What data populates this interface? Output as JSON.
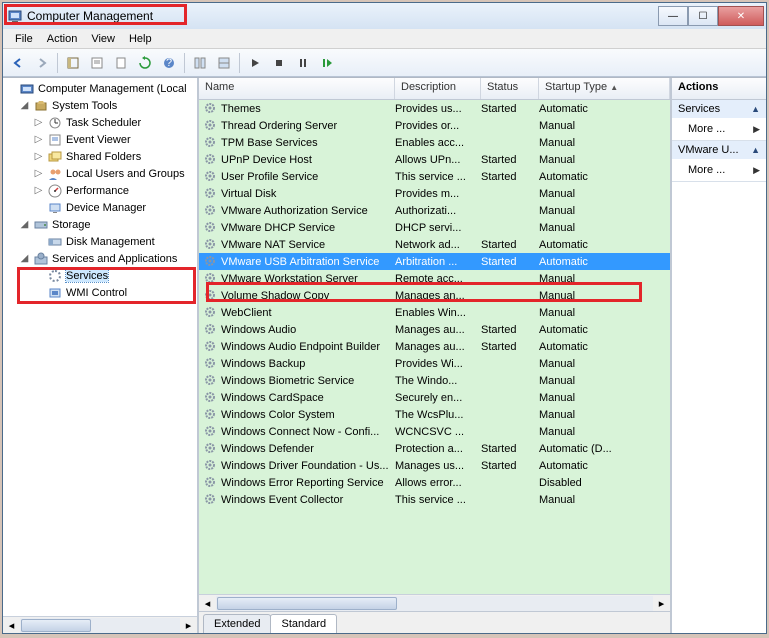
{
  "window": {
    "title": "Computer Management"
  },
  "menu": {
    "file": "File",
    "action": "Action",
    "view": "View",
    "help": "Help"
  },
  "tree": {
    "root": "Computer Management (Local",
    "systemTools": "System Tools",
    "taskScheduler": "Task Scheduler",
    "eventViewer": "Event Viewer",
    "sharedFolders": "Shared Folders",
    "localUsers": "Local Users and Groups",
    "performance": "Performance",
    "deviceManager": "Device Manager",
    "storage": "Storage",
    "diskManagement": "Disk Management",
    "servicesApps": "Services and Applications",
    "services": "Services",
    "wmiControl": "WMI Control"
  },
  "columns": {
    "name": "Name",
    "description": "Description",
    "status": "Status",
    "startup": "Startup Type"
  },
  "services": [
    {
      "name": "Themes",
      "desc": "Provides us...",
      "status": "Started",
      "startup": "Automatic"
    },
    {
      "name": "Thread Ordering Server",
      "desc": "Provides or...",
      "status": "",
      "startup": "Manual"
    },
    {
      "name": "TPM Base Services",
      "desc": "Enables acc...",
      "status": "",
      "startup": "Manual"
    },
    {
      "name": "UPnP Device Host",
      "desc": "Allows UPn...",
      "status": "Started",
      "startup": "Manual"
    },
    {
      "name": "User Profile Service",
      "desc": "This service ...",
      "status": "Started",
      "startup": "Automatic"
    },
    {
      "name": "Virtual Disk",
      "desc": "Provides m...",
      "status": "",
      "startup": "Manual"
    },
    {
      "name": "VMware Authorization Service",
      "desc": "Authorizati...",
      "status": "",
      "startup": "Manual"
    },
    {
      "name": "VMware DHCP Service",
      "desc": "DHCP servi...",
      "status": "",
      "startup": "Manual"
    },
    {
      "name": "VMware NAT Service",
      "desc": "Network ad...",
      "status": "Started",
      "startup": "Automatic"
    },
    {
      "name": "VMware USB Arbitration Service",
      "desc": "Arbitration ...",
      "status": "Started",
      "startup": "Automatic",
      "selected": true
    },
    {
      "name": "VMware Workstation Server",
      "desc": "Remote acc...",
      "status": "",
      "startup": "Manual"
    },
    {
      "name": "Volume Shadow Copy",
      "desc": "Manages an...",
      "status": "",
      "startup": "Manual"
    },
    {
      "name": "WebClient",
      "desc": "Enables Win...",
      "status": "",
      "startup": "Manual"
    },
    {
      "name": "Windows Audio",
      "desc": "Manages au...",
      "status": "Started",
      "startup": "Automatic"
    },
    {
      "name": "Windows Audio Endpoint Builder",
      "desc": "Manages au...",
      "status": "Started",
      "startup": "Automatic"
    },
    {
      "name": "Windows Backup",
      "desc": "Provides Wi...",
      "status": "",
      "startup": "Manual"
    },
    {
      "name": "Windows Biometric Service",
      "desc": "The Windo...",
      "status": "",
      "startup": "Manual"
    },
    {
      "name": "Windows CardSpace",
      "desc": "Securely en...",
      "status": "",
      "startup": "Manual"
    },
    {
      "name": "Windows Color System",
      "desc": "The WcsPlu...",
      "status": "",
      "startup": "Manual"
    },
    {
      "name": "Windows Connect Now - Confi...",
      "desc": "WCNCSVC ...",
      "status": "",
      "startup": "Manual"
    },
    {
      "name": "Windows Defender",
      "desc": "Protection a...",
      "status": "Started",
      "startup": "Automatic (D..."
    },
    {
      "name": "Windows Driver Foundation - Us...",
      "desc": "Manages us...",
      "status": "Started",
      "startup": "Automatic"
    },
    {
      "name": "Windows Error Reporting Service",
      "desc": "Allows error...",
      "status": "",
      "startup": "Disabled"
    },
    {
      "name": "Windows Event Collector",
      "desc": "This service ...",
      "status": "",
      "startup": "Manual"
    }
  ],
  "tabs": {
    "extended": "Extended",
    "standard": "Standard"
  },
  "actions": {
    "header": "Actions",
    "group1": "Services",
    "group2": "VMware U...",
    "more": "More ..."
  }
}
